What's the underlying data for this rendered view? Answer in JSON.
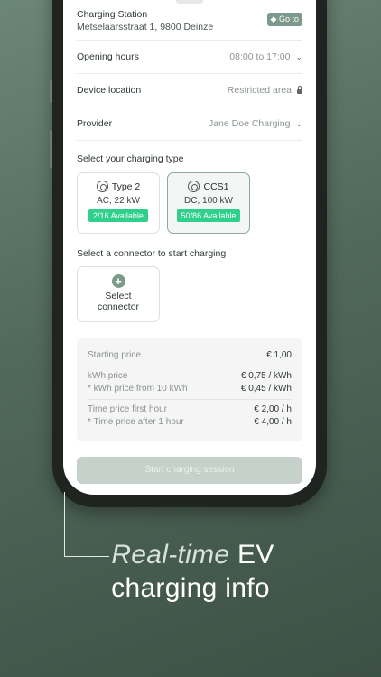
{
  "station": {
    "title": "Charging Station",
    "address": "Metselaarsstraat 1, 9800 Deinze",
    "goto_label": "Go to"
  },
  "details": [
    {
      "label": "Opening hours",
      "value": "08:00 to 17:00",
      "icon": "chevron-down-icon"
    },
    {
      "label": "Device location",
      "value": "Restricted area",
      "icon": "lock-icon"
    },
    {
      "label": "Provider",
      "value": "Jane Doe Charging",
      "icon": "chevron-down-icon"
    }
  ],
  "charging_type": {
    "title": "Select your charging type",
    "types": [
      {
        "name": "Type 2",
        "spec": "AC, 22 kW",
        "available": "2/16 Available",
        "selected": false
      },
      {
        "name": "CCS1",
        "spec": "DC, 100 kW",
        "available": "50/86 Available",
        "selected": true
      }
    ]
  },
  "connector": {
    "title": "Select a connector to start charging",
    "card_label_line1": "Select",
    "card_label_line2": "connector"
  },
  "pricing": {
    "starting_label": "Starting price",
    "starting_value": "€ 1,00",
    "kwh_label": "kWh price",
    "kwh_value": "€ 0,75 / kWh",
    "kwh_after_label": "* kWh price from 10 kWh",
    "kwh_after_value": "€ 0,45 / kWh",
    "time_label": "Time price first hour",
    "time_value": "€ 2,00 / h",
    "time_after_label": "* Time price after 1 hour",
    "time_after_value": "€ 4,00 / h"
  },
  "start_button": "Start charging session",
  "caption": {
    "line1_italic": "Real-time",
    "line1_rest": "EV",
    "line2": "charging info"
  },
  "colors": {
    "accent": "#7c9a8b",
    "available_badge": "#2fcf8c",
    "background": "#51695b"
  }
}
